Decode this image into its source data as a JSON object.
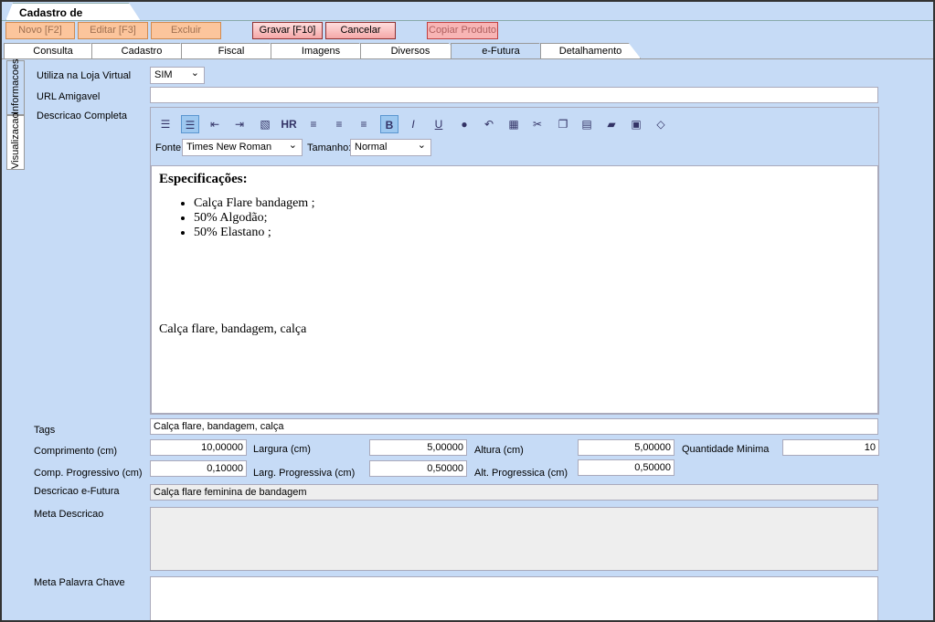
{
  "window": {
    "tab_title": "Cadastro de Produtos",
    "close": "✕"
  },
  "toolbar": {
    "novo": "Novo [F2]",
    "editar": "Editar [F3]",
    "excluir": "Excluir",
    "gravar": "Gravar [F10]",
    "cancelar": "Cancelar",
    "copiar": "Copiar Produto"
  },
  "tabs": [
    "Consulta",
    "Cadastro",
    "Fiscal",
    "Imagens",
    "Diversos",
    "e-Futura",
    "Detalhamento"
  ],
  "active_tab": "e-Futura",
  "side_tabs": [
    "Informacoes",
    "Visualizacao"
  ],
  "form": {
    "loja_virtual_label": "Utiliza na Loja Virtual",
    "loja_virtual_value": "SIM",
    "url_label": "URL Amigavel",
    "url_value": "",
    "descricao_label": "Descricao Completa",
    "fonte_label": "Fonte:",
    "fonte_value": "Times New Roman",
    "tamanho_label": "Tamanho:",
    "tamanho_value": "Normal",
    "editor": {
      "heading": "Especificações:",
      "items": [
        "Calça Flare bandagem ;",
        "50% Algodão;",
        "50% Elastano ;"
      ],
      "footer": "Calça flare, bandagem, calça"
    },
    "tags_label": "Tags",
    "tags_value": "Calça flare, bandagem, calça",
    "comprimento_label": "Comprimento (cm)",
    "comprimento_value": "10,00000",
    "largura_label": "Largura (cm)",
    "largura_value": "5,00000",
    "altura_label": "Altura (cm)",
    "altura_value": "5,00000",
    "qtd_label": "Quantidade Minima",
    "qtd_value": "10",
    "comp_prog_label": "Comp. Progressivo (cm)",
    "comp_prog_value": "0,10000",
    "larg_prog_label": "Larg. Progressiva (cm)",
    "larg_prog_value": "0,50000",
    "alt_prog_label": "Alt. Progressica (cm)",
    "alt_prog_value": "0,50000",
    "desc_efutura_label": "Descricao e-Futura",
    "desc_efutura_value": "Calça flare feminina de bandagem",
    "meta_desc_label": "Meta Descricao",
    "meta_desc_value": "",
    "meta_palavra_label": "Meta Palavra Chave",
    "meta_palavra_value": ""
  },
  "editor_toolbar": [
    "ordered-list-icon",
    "unordered-list-icon",
    "outdent-icon",
    "indent-icon",
    "image-icon",
    "hr-icon",
    "align-left-icon",
    "align-right-icon",
    "align-center-icon",
    "bold-icon",
    "italic-icon",
    "underline-icon",
    "link-icon",
    "undo-icon",
    "color-icon",
    "cut-icon",
    "copy-icon",
    "paste-icon",
    "open-icon",
    "save-icon",
    "source-icon"
  ]
}
